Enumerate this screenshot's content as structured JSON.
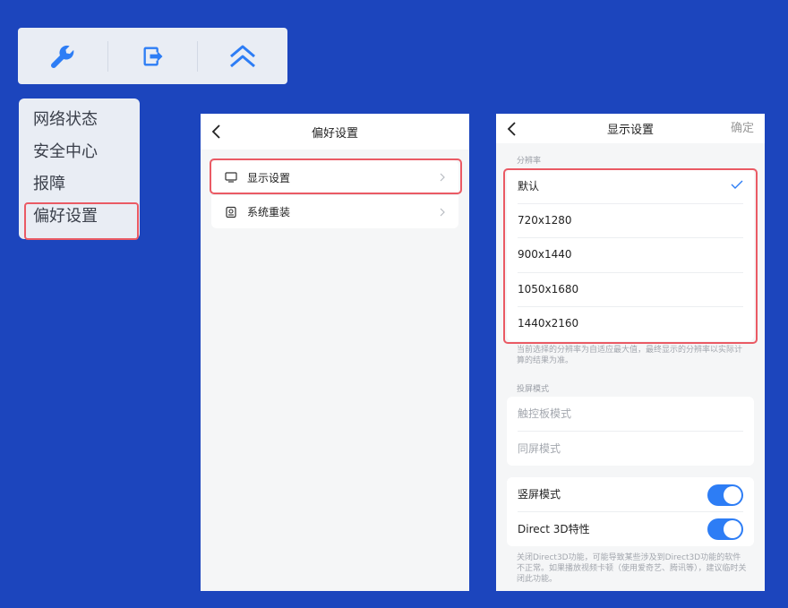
{
  "toolbar": {
    "icons": [
      "wrench-icon",
      "exit-icon",
      "double-chevron-up-icon"
    ],
    "accent": "#2d7df5"
  },
  "menu": {
    "items": [
      {
        "label": "网络状态"
      },
      {
        "label": "安全中心"
      },
      {
        "label": "报障"
      },
      {
        "label": "偏好设置"
      }
    ]
  },
  "prefs": {
    "title": "偏好设置",
    "items": [
      {
        "label": "显示设置",
        "icon": "monitor-icon"
      },
      {
        "label": "系统重装",
        "icon": "reinstall-icon"
      }
    ]
  },
  "display": {
    "title": "显示设置",
    "confirm": "确定",
    "resolution_label": "分辨率",
    "resolutions": [
      {
        "label": "默认",
        "selected": true
      },
      {
        "label": "720x1280"
      },
      {
        "label": "900x1440"
      },
      {
        "label": "1050x1680"
      },
      {
        "label": "1440x2160"
      }
    ],
    "resolution_note": "当前选择的分辨率为自适应最大值，最终显示的分辨率以实际计算的结果为准。",
    "cast_label": "投屏模式",
    "cast_modes": [
      {
        "label": "触控板模式"
      },
      {
        "label": "同屏模式"
      }
    ],
    "toggles": [
      {
        "label": "竖屏模式",
        "on": true
      },
      {
        "label": "Direct 3D特性",
        "on": true
      }
    ],
    "d3d_note": "关闭Direct3D功能，可能导致某些涉及到Direct3D功能的软件不正常。如果播放视频卡顿（使用爱奇艺、腾讯等），建议临时关闭此功能。"
  }
}
